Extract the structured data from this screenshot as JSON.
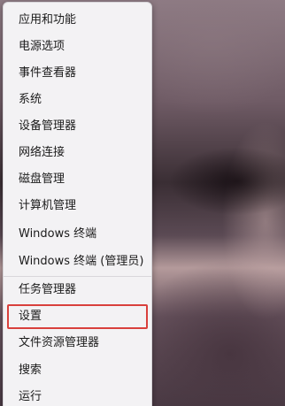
{
  "context_menu": {
    "items": [
      {
        "label": "应用和功能"
      },
      {
        "label": "电源选项"
      },
      {
        "label": "事件查看器"
      },
      {
        "label": "系统"
      },
      {
        "label": "设备管理器"
      },
      {
        "label": "网络连接"
      },
      {
        "label": "磁盘管理"
      },
      {
        "label": "计算机管理"
      },
      {
        "label": "Windows 终端"
      },
      {
        "label": "Windows 终端 (管理员)"
      },
      {
        "label": "任务管理器"
      },
      {
        "label": "设置",
        "highlighted": true
      },
      {
        "label": "文件资源管理器"
      },
      {
        "label": "搜索"
      },
      {
        "label": "运行"
      }
    ]
  },
  "colors": {
    "menu_background": "#f3f2f4",
    "highlight_border": "#d9403c",
    "text": "#1b1b1b"
  }
}
